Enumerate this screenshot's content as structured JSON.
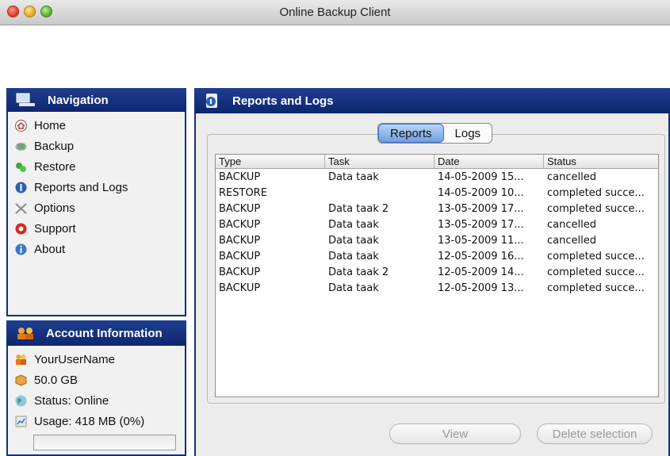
{
  "window": {
    "title": "Online Backup Client"
  },
  "navigation": {
    "header": "Navigation",
    "items": [
      {
        "label": "Home",
        "icon": "home-icon"
      },
      {
        "label": "Backup",
        "icon": "backup-icon"
      },
      {
        "label": "Restore",
        "icon": "restore-icon"
      },
      {
        "label": "Reports and Logs",
        "icon": "reports-icon"
      },
      {
        "label": "Options",
        "icon": "options-icon"
      },
      {
        "label": "Support",
        "icon": "support-icon"
      },
      {
        "label": "About",
        "icon": "about-icon"
      }
    ]
  },
  "account": {
    "header": "Account Information",
    "username": "YourUserName",
    "quota": "50.0 GB",
    "status": "Status: Online",
    "usage": "Usage: 418 MB (0%)",
    "usage_fraction": 0.0
  },
  "main": {
    "header": "Reports and Logs",
    "tabs": [
      {
        "label": "Reports",
        "active": true
      },
      {
        "label": "Logs",
        "active": false
      }
    ],
    "table": {
      "columns": [
        "Type",
        "Task",
        "Date",
        "Status"
      ],
      "rows": [
        [
          "BACKUP",
          "Data taak",
          "14-05-2009 15...",
          "cancelled"
        ],
        [
          "RESTORE",
          "",
          "14-05-2009 10...",
          "completed succe..."
        ],
        [
          "BACKUP",
          "Data taak 2",
          "13-05-2009 17...",
          "completed succe..."
        ],
        [
          "BACKUP",
          "Data taak",
          "13-05-2009 17...",
          "cancelled"
        ],
        [
          "BACKUP",
          "Data taak",
          "13-05-2009 11...",
          "cancelled"
        ],
        [
          "BACKUP",
          "Data taak",
          "12-05-2009 16...",
          "completed succe..."
        ],
        [
          "BACKUP",
          "Data taak 2",
          "12-05-2009 14...",
          "completed succe..."
        ],
        [
          "BACKUP",
          "Data taak",
          "12-05-2009 13...",
          "completed succe..."
        ]
      ]
    },
    "buttons": {
      "view": "View",
      "delete": "Delete selection"
    }
  },
  "colors": {
    "accent": "#14307c",
    "tab_active": "#6f9fe0"
  }
}
